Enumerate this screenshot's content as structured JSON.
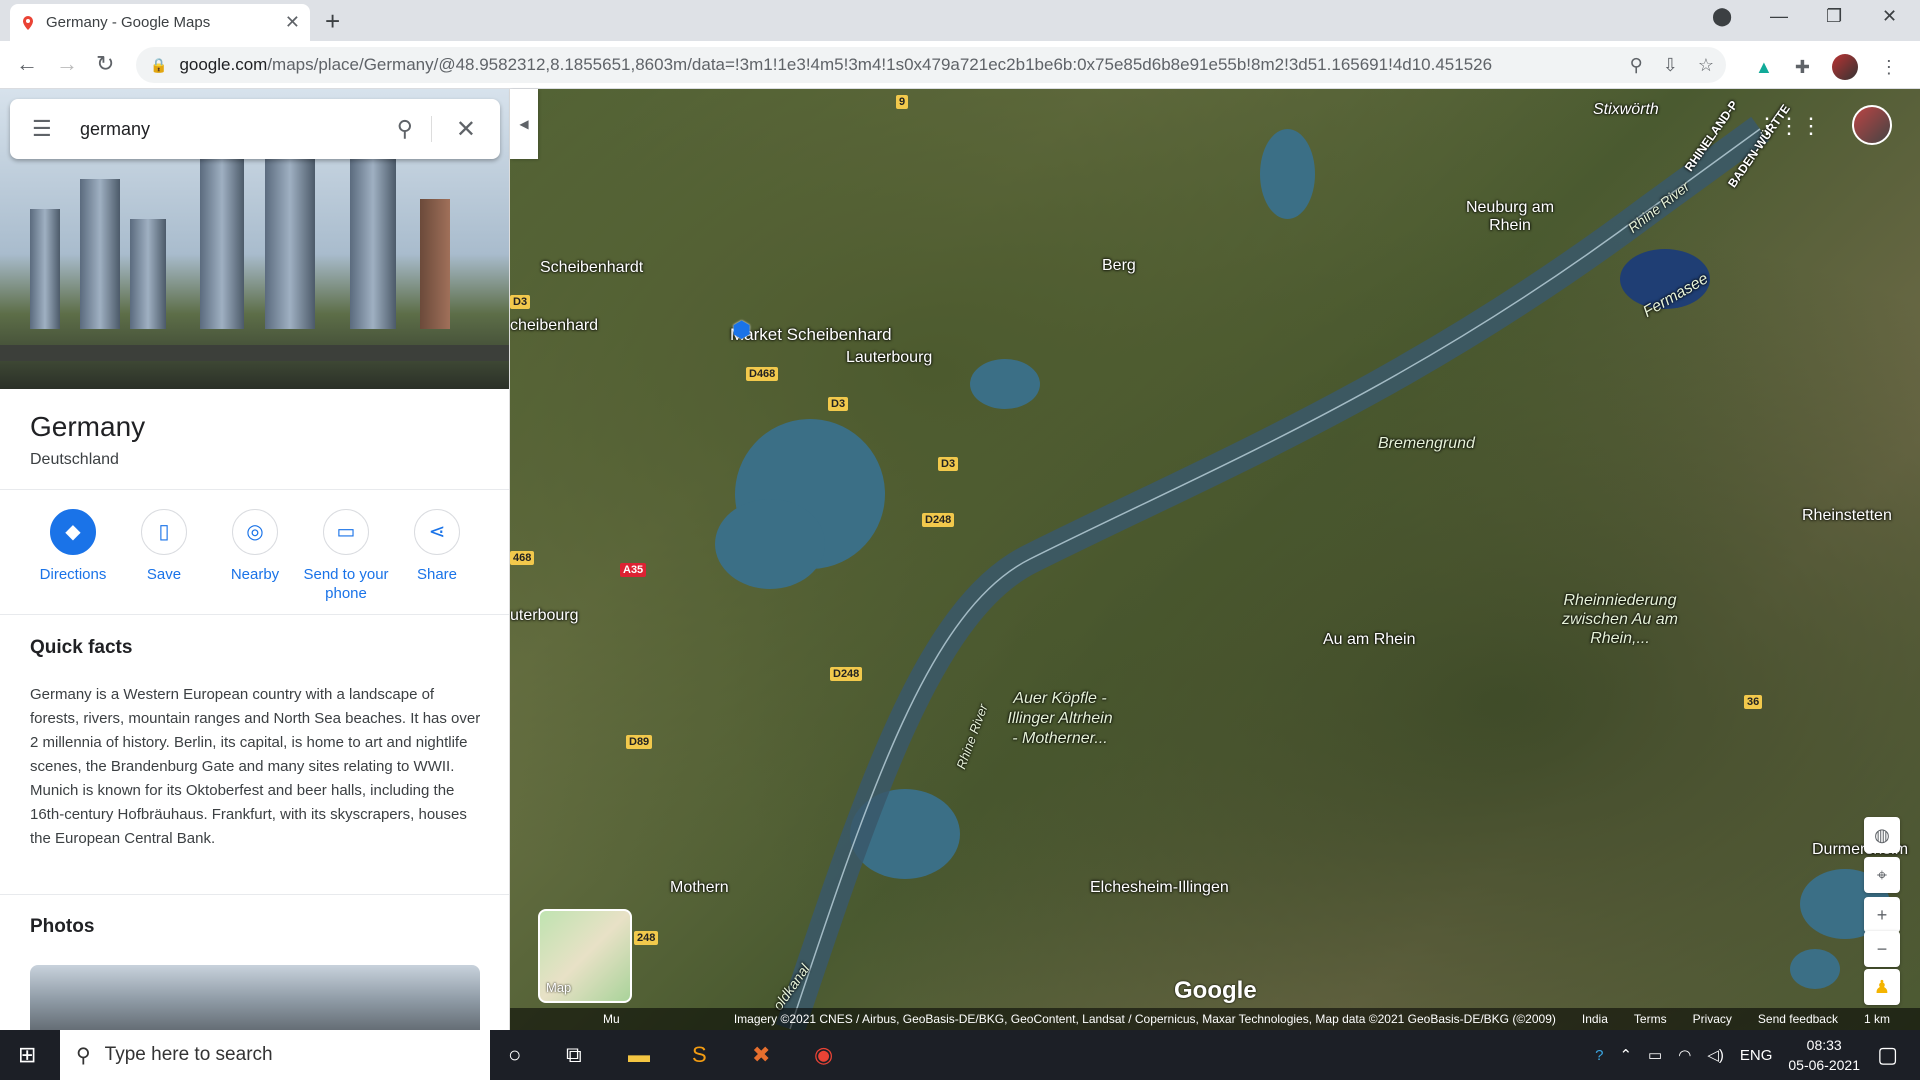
{
  "browser": {
    "tab_title": "Germany - Google Maps",
    "url_host": "google.com",
    "url_path": "/maps/place/Germany/@48.9582312,8.1855651,8603m/data=!3m1!1e3!4m5!3m4!1s0x479a721ec2b1be6b:0x75e85d6b8e91e55b!8m2!3d51.165691!4d10.451526"
  },
  "search": {
    "query": "germany"
  },
  "place": {
    "title": "Germany",
    "subtitle": "Deutschland",
    "actions": [
      {
        "label": "Directions",
        "icon": "directions-icon"
      },
      {
        "label": "Save",
        "icon": "bookmark-icon"
      },
      {
        "label": "Nearby",
        "icon": "nearby-icon"
      },
      {
        "label": "Send to your phone",
        "icon": "phone-icon"
      },
      {
        "label": "Share",
        "icon": "share-icon"
      }
    ],
    "quick_facts_title": "Quick facts",
    "quick_facts_text": "Germany is a Western European country with a landscape of forests, rivers, mountain ranges and North Sea beaches. It has over 2 millennia of history. Berlin, its capital, is home to art and nightlife scenes, the Brandenburg Gate and many sites relating to WWII. Munich is known for its Oktoberfest and beer halls, including the 16th-century Hofbräuhaus. Frankfurt, with its skyscrapers, houses the European Central Bank.",
    "photos_title": "Photos"
  },
  "map": {
    "labels": {
      "stixworth": "Stixwörth",
      "rhineland": "RHINELAND-P",
      "baden": "BADEN-WÜRTTE",
      "neuburg": "Neuburg am Rhein",
      "scheibenhardt": "Scheibenhardt",
      "scheibenhard": "cheibenhard",
      "berg": "Berg",
      "rhine_river_top": "Rhine River",
      "fermasee": "Fermasee",
      "market": "Market Scheibenhard",
      "lauterbourg": "Lauterbourg",
      "bremengrund": "Bremengrund",
      "rheinstetten": "Rheinstetten",
      "terbourg": "uterbourg",
      "au_am_rhein": "Au am Rhein",
      "rheinniederung": "Rheinniederung zwischen Au am Rhein,...",
      "auer_kopfle": "Auer Köpfle - Illinger Altrhein - Motherner...",
      "rhine_river_low": "Rhine River",
      "durmersheim": "Durmersheim",
      "mothern": "Mothern",
      "elchesheim": "Elchesheim-Illingen",
      "oldkanal": "oldkanal"
    },
    "road_tags": {
      "r9": "9",
      "d3a": "D3",
      "d468": "D468",
      "d3b": "D3",
      "d3c": "D3",
      "d248a": "D248",
      "a35": "A35",
      "r468": "468",
      "d248b": "D248",
      "d89": "D89",
      "r248": "248",
      "r36": "36"
    },
    "layer_toggle": "Map",
    "logo": "Google",
    "attribution": {
      "mu": "Mu",
      "imagery": "Imagery ©2021 CNES / Airbus, GeoBasis-DE/BKG, GeoContent, Landsat / Copernicus, Maxar Technologies, Map data ©2021 GeoBasis-DE/BKG (©2009)",
      "india": "India",
      "terms": "Terms",
      "privacy": "Privacy",
      "feedback": "Send feedback",
      "scale": "1 km"
    }
  },
  "taskbar": {
    "search_placeholder": "Type here to search",
    "lang": "ENG",
    "time": "08:33",
    "date": "05-06-2021"
  }
}
